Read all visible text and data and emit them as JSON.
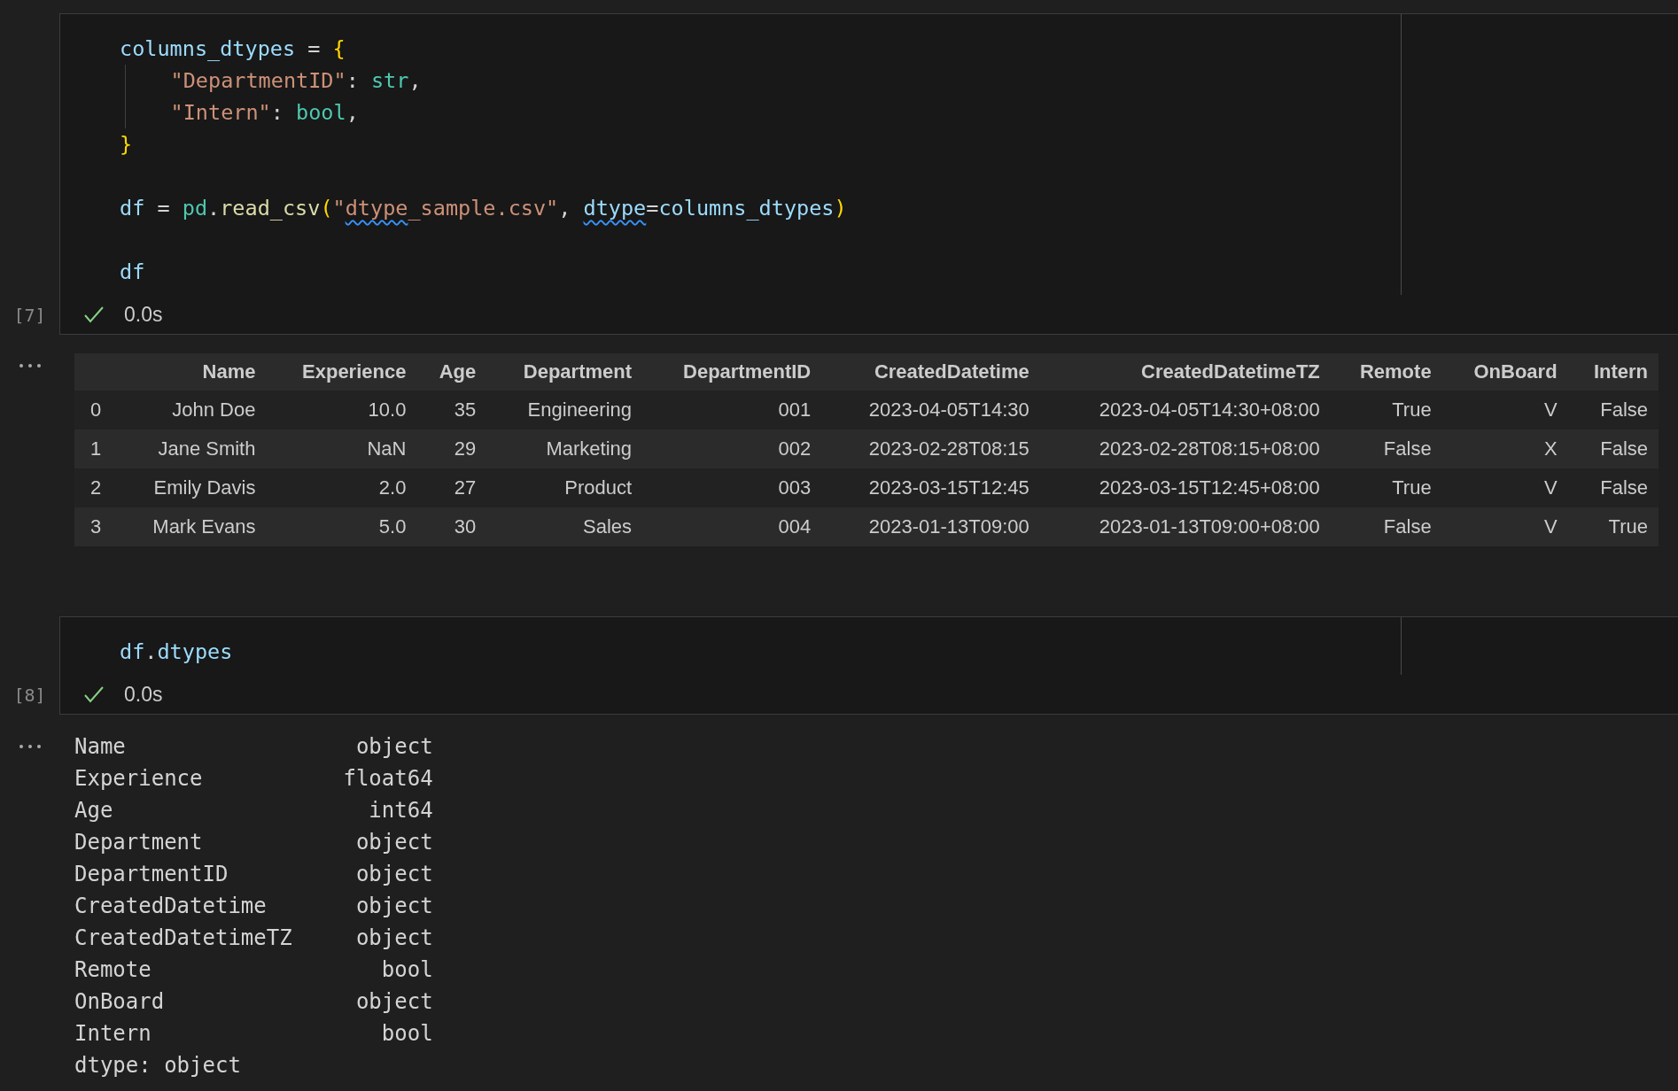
{
  "cells": [
    {
      "execution_count": "[7]",
      "succeeded": true,
      "duration": "0.0s",
      "code": [
        {
          "kind": "code",
          "indented": false,
          "tokens": [
            {
              "t": "columns_dtypes",
              "kind": "var"
            },
            {
              "t": " = ",
              "kind": "op"
            },
            {
              "t": "{",
              "kind": "brace"
            }
          ]
        },
        {
          "kind": "code",
          "indented": true,
          "tokens": [
            {
              "t": "\"DepartmentID\"",
              "kind": "str"
            },
            {
              "t": ": ",
              "kind": "op"
            },
            {
              "t": "str",
              "kind": "type"
            },
            {
              "t": ",",
              "kind": "op"
            }
          ]
        },
        {
          "kind": "code",
          "indented": true,
          "tokens": [
            {
              "t": "\"Intern\"",
              "kind": "str"
            },
            {
              "t": ": ",
              "kind": "op"
            },
            {
              "t": "bool",
              "kind": "type"
            },
            {
              "t": ",",
              "kind": "op"
            }
          ]
        },
        {
          "kind": "code",
          "indented": false,
          "tokens": [
            {
              "t": "}",
              "kind": "brace"
            }
          ]
        },
        {
          "kind": "blank"
        },
        {
          "kind": "code",
          "indented": false,
          "tokens": [
            {
              "t": "df",
              "kind": "var"
            },
            {
              "t": " = ",
              "kind": "op"
            },
            {
              "t": "pd",
              "kind": "type"
            },
            {
              "t": ".",
              "kind": "op"
            },
            {
              "t": "read_csv",
              "kind": "func"
            },
            {
              "t": "(",
              "kind": "brace"
            },
            {
              "t": "\"",
              "kind": "str"
            },
            {
              "t": "dtype",
              "kind": "str_flagged"
            },
            {
              "t": "_sample.csv\"",
              "kind": "str"
            },
            {
              "t": ", ",
              "kind": "op"
            },
            {
              "t": "dtype",
              "kind": "var_flagged"
            },
            {
              "t": "=",
              "kind": "op"
            },
            {
              "t": "columns_dtypes",
              "kind": "var"
            },
            {
              "t": ")",
              "kind": "brace"
            }
          ]
        },
        {
          "kind": "blank"
        },
        {
          "kind": "code",
          "indented": false,
          "tokens": [
            {
              "t": "df",
              "kind": "var"
            }
          ]
        }
      ],
      "output": {
        "kind": "dataframe",
        "columns": [
          "Name",
          "Experience",
          "Age",
          "Department",
          "DepartmentID",
          "CreatedDatetime",
          "CreatedDatetimeTZ",
          "Remote",
          "OnBoard",
          "Intern"
        ],
        "rows": [
          {
            "index": "0",
            "cells": [
              "John Doe",
              "10.0",
              "35",
              "Engineering",
              "001",
              "2023-04-05T14:30",
              "2023-04-05T14:30+08:00",
              "True",
              "V",
              "False"
            ]
          },
          {
            "index": "1",
            "cells": [
              "Jane Smith",
              "NaN",
              "29",
              "Marketing",
              "002",
              "2023-02-28T08:15",
              "2023-02-28T08:15+08:00",
              "False",
              "X",
              "False"
            ]
          },
          {
            "index": "2",
            "cells": [
              "Emily Davis",
              "2.0",
              "27",
              "Product",
              "003",
              "2023-03-15T12:45",
              "2023-03-15T12:45+08:00",
              "True",
              "V",
              "False"
            ]
          },
          {
            "index": "3",
            "cells": [
              "Mark Evans",
              "5.0",
              "30",
              "Sales",
              "004",
              "2023-01-13T09:00",
              "2023-01-13T09:00+08:00",
              "False",
              "V",
              "True"
            ]
          }
        ]
      }
    },
    {
      "execution_count": "[8]",
      "succeeded": true,
      "duration": "0.0s",
      "code": [
        {
          "kind": "code",
          "indented": false,
          "tokens": [
            {
              "t": "df",
              "kind": "var"
            },
            {
              "t": ".",
              "kind": "op"
            },
            {
              "t": "dtypes",
              "kind": "var"
            }
          ]
        }
      ],
      "output": {
        "kind": "text",
        "lines": [
          "Name                  object",
          "Experience           float64",
          "Age                    int64",
          "Department            object",
          "DepartmentID          object",
          "CreatedDatetime       object",
          "CreatedDatetimeTZ     object",
          "Remote                  bool",
          "OnBoard               object",
          "Intern                  bool",
          "dtype: object"
        ]
      }
    }
  ]
}
